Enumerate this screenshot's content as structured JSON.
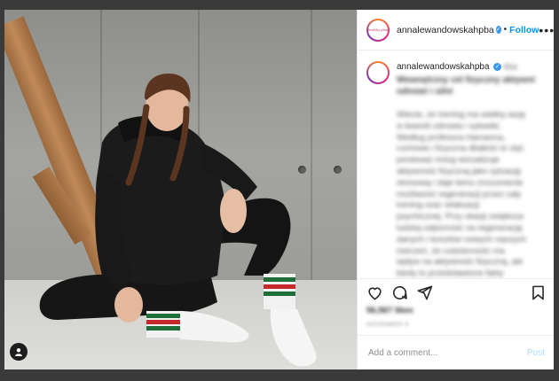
{
  "post": {
    "username": "annalewandowskahpba",
    "verified_icon": "verified-badge-icon",
    "follow_label": "Follow",
    "more_icon": "more-options-icon",
    "avatar_text": "healthy plan",
    "caption": {
      "username": "annalewandowskahpba",
      "headline": "Wewnętrzny cel fizyczny aktywni odnowi i silni",
      "time_short": "61w",
      "body": "Wiecie, że trening ma wielką rację w kwestii zdrowia i sylwetki. Według profesora Hamanna, ruchowa i fizyczna dbałość to styl, ponieważ mózg wizualizuje aktywność fizyczną jako sytuację stresową i daje temu zrozumienie możliwość regeneracji przez cały trening oraz relaksacji psychicznej. Przy okazji zwiększa ludzką odporność na regenerację danych i kosztów nowych naszych ćwiczeń, że codzienność ma wpływ na aktywność fizyczną, ale kiedy to przedstawione fakty bardzo dodatkowym bodźcem do ruchu"
    },
    "likes": "56,567 likes",
    "date": "NOVEMBER 9",
    "comment_placeholder": "Add a comment...",
    "post_label": "Post",
    "icons": [
      "heart-icon",
      "comment-icon",
      "share-icon",
      "bookmark-icon",
      "user-tag-icon"
    ],
    "colors": {
      "accent": "#0095f6",
      "post_disabled": "#b2dffc",
      "backdrop": "#3a3a3a"
    }
  }
}
